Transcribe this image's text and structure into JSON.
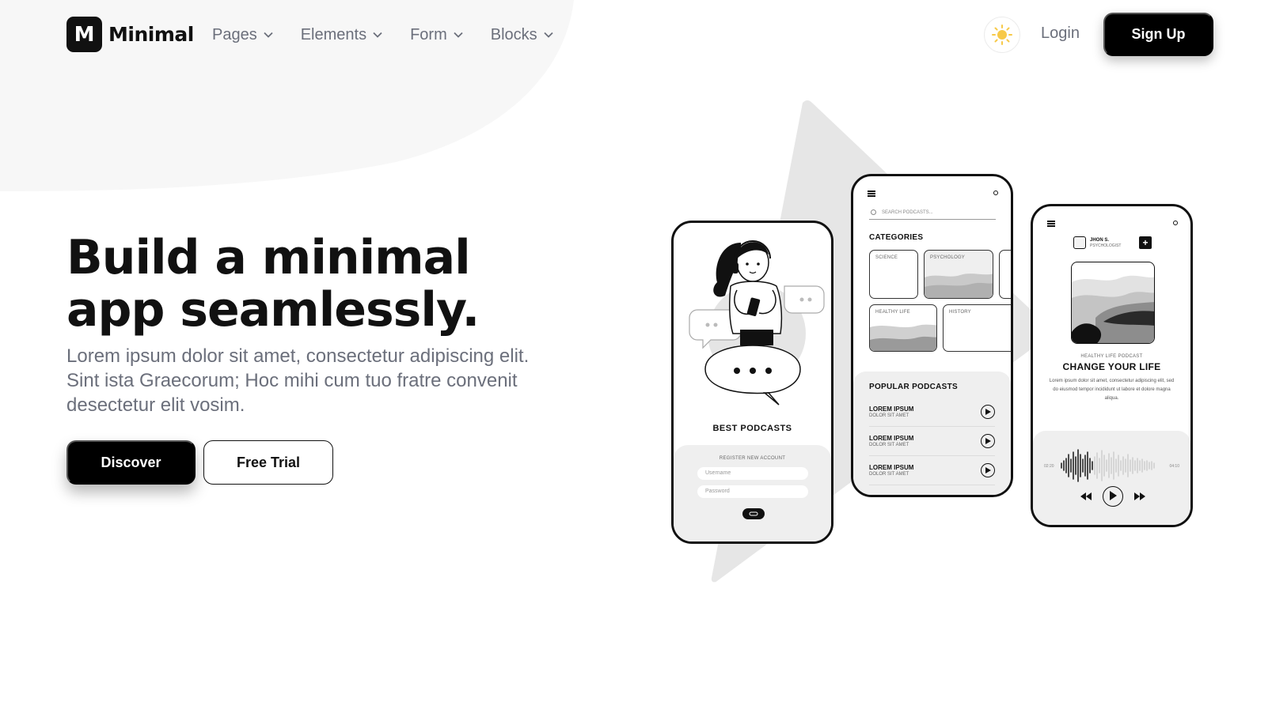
{
  "brand": {
    "logo_letter": "M",
    "name": "Minimal"
  },
  "nav": {
    "items": [
      {
        "label": "Pages"
      },
      {
        "label": "Elements"
      },
      {
        "label": "Form"
      },
      {
        "label": "Blocks"
      }
    ],
    "theme_icon": "sun-icon",
    "login_label": "Login",
    "signup_label": "Sign Up"
  },
  "hero": {
    "title": "Build a minimal app seamlessly.",
    "subtitle": "Lorem ipsum dolor sit amet, consectetur adipiscing elit. Sint ista Graecorum; Hoc mihi cum tuo fratre convenit desectetur elit vosim.",
    "primary_cta": "Discover",
    "secondary_cta": "Free Trial"
  },
  "colors": {
    "primary": "#000000",
    "text_muted": "#6b6f7b",
    "sun": "#f7c948",
    "blob": "#f7f7f7",
    "triangle": "#e6e6e6"
  },
  "mockups": {
    "phone1": {
      "title": "BEST PODCASTS",
      "register_label": "REGISTER NEW ACCOUNT",
      "username_placeholder": "Username",
      "password_placeholder": "Password"
    },
    "phone2": {
      "search_placeholder": "SEARCH PODCASTS...",
      "categories_title": "CATEGORIES",
      "categories": [
        {
          "label": "SCIENCE"
        },
        {
          "label": "PSYCHOLOGY"
        },
        {
          "label": "HEALTHY LIFE"
        },
        {
          "label": "HISTORY"
        }
      ],
      "popular_title": "POPULAR PODCASTS",
      "podcasts": [
        {
          "title": "LOREM IPSUM",
          "subtitle": "DOLOR SIT AMET"
        },
        {
          "title": "LOREM IPSUM",
          "subtitle": "DOLOR SIT AMET"
        },
        {
          "title": "LOREM IPSUM",
          "subtitle": "DOLOR SIT AMET"
        }
      ]
    },
    "phone3": {
      "author_name": "JHON S.",
      "author_role": "PSYCHOLOGIST",
      "plus": "+",
      "kicker": "HEALTHY LIFE PODCAST",
      "title": "CHANGE YOUR LIFE",
      "description": "Lorem ipsum dolor sit amet, consectetur adipiscing elit, sed do eiusmod tempor incididunt ut labore et dolore magna aliqua.",
      "time_elapsed": "02:20",
      "time_total": "04:10"
    }
  }
}
